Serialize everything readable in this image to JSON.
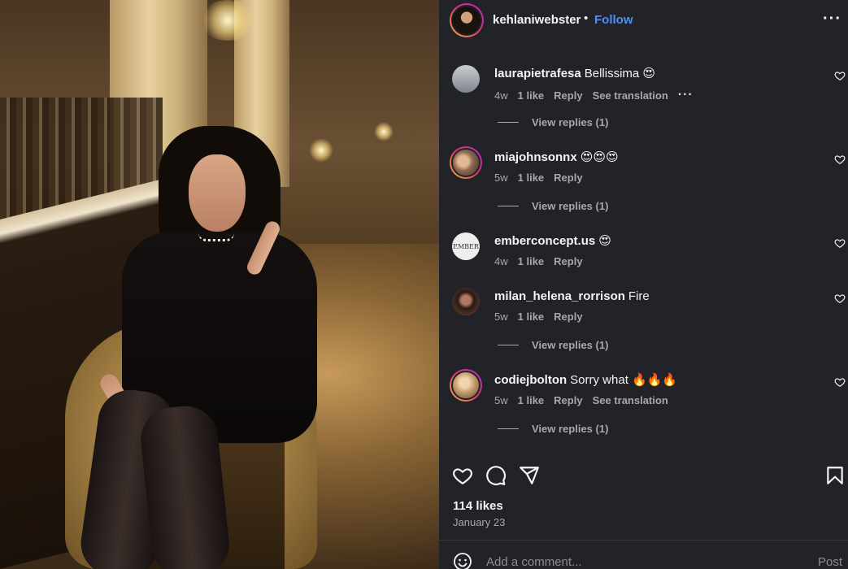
{
  "post_author": {
    "username": "kehlaniwebster",
    "separator": "•",
    "follow_label": "Follow",
    "more_icon": "more-horizontal-icon"
  },
  "comments": [
    {
      "username": "laurapietrafesa",
      "text": "Bellissima 😍",
      "age": "4w",
      "likes": "1 like",
      "reply": "Reply",
      "translation": "See translation",
      "more": "···",
      "view_replies": "View replies (1)",
      "avatar_ring": false,
      "avatar_color": "#8d9298"
    },
    {
      "username": "miajohnsonnx",
      "text": "😍😍😍",
      "age": "5w",
      "likes": "1 like",
      "reply": "Reply",
      "view_replies": "View replies (1)",
      "avatar_ring": true,
      "avatar_color": "#c59a78"
    },
    {
      "username": "emberconcept.us",
      "text": "😍",
      "age": "4w",
      "likes": "1 like",
      "reply": "Reply",
      "avatar_ring": false,
      "avatar_color": "#eeeeee",
      "avatar_text": "EMBER"
    },
    {
      "username": "milan_helena_rorrison",
      "text": "Fire",
      "age": "5w",
      "likes": "1 like",
      "reply": "Reply",
      "view_replies": "View replies (1)",
      "avatar_ring": false,
      "avatar_color": "#5a3e34"
    },
    {
      "username": "codiejbolton",
      "text": "Sorry what 🔥🔥🔥",
      "age": "5w",
      "likes": "1 like",
      "reply": "Reply",
      "translation": "See translation",
      "view_replies": "View replies (1)",
      "avatar_ring": true,
      "avatar_color": "#d8b48a"
    }
  ],
  "actions": {
    "like_icon": "heart-icon",
    "comment_icon": "comment-icon",
    "share_icon": "send-icon",
    "save_icon": "bookmark-icon"
  },
  "stats": {
    "likes": "114 likes",
    "date": "January 23"
  },
  "composer": {
    "placeholder": "Add a comment...",
    "post_label": "Post",
    "emoji_icon": "emoji-icon"
  },
  "colors": {
    "accent": "#4f8ef7",
    "panel_bg": "#212328",
    "secondary_text": "#a8a8a8"
  }
}
